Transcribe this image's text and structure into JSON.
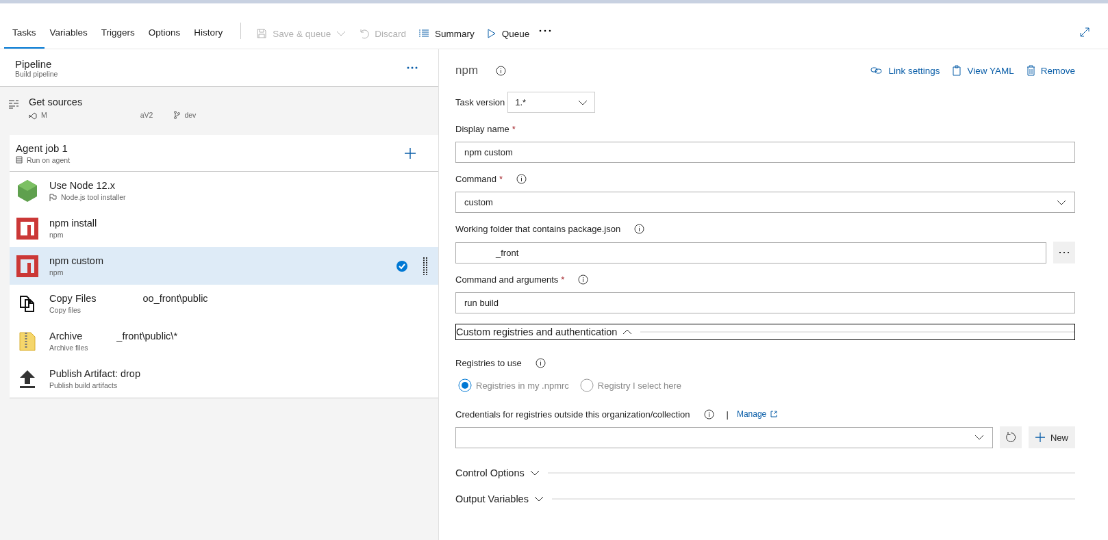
{
  "tabs": [
    {
      "label": "Tasks",
      "selected": true
    },
    {
      "label": "Variables",
      "selected": false
    },
    {
      "label": "Triggers",
      "selected": false
    },
    {
      "label": "Options",
      "selected": false
    },
    {
      "label": "History",
      "selected": false
    }
  ],
  "toolbar": [
    {
      "kind": "save",
      "label": "Save & queue",
      "disabled": true
    },
    {
      "kind": "discard",
      "label": "Discard",
      "disabled": true
    },
    {
      "kind": "summary",
      "label": "Summary",
      "disabled": false
    },
    {
      "kind": "queue",
      "label": "Queue",
      "disabled": false
    }
  ],
  "pipeline": {
    "title": "Pipeline",
    "subtitle": "Build pipeline"
  },
  "get_sources": {
    "title": "Get sources",
    "repo_start": "M",
    "repo_end": "aV2",
    "branch": "dev"
  },
  "agent_job": {
    "title": "Agent job 1",
    "subtitle": "Run on agent"
  },
  "tasks": [
    {
      "kind": "node",
      "title": "Use Node 12.x",
      "subtitle": "Node.js tool installer",
      "selected": false
    },
    {
      "kind": "npm",
      "title": "npm install",
      "subtitle": "npm",
      "selected": false
    },
    {
      "kind": "npm",
      "title": "npm custom",
      "subtitle": "npm",
      "selected": true
    },
    {
      "kind": "copy",
      "title": "Copy Files",
      "title_end": "oo_front\\public",
      "subtitle": "Copy files",
      "selected": false
    },
    {
      "kind": "archive",
      "title": "Archive",
      "title_end": "_front\\public\\*",
      "subtitle": "Archive files",
      "selected": false
    },
    {
      "kind": "publish",
      "title": "Publish Artifact: drop",
      "subtitle": "Publish build artifacts",
      "selected": false
    }
  ],
  "detail": {
    "title": "npm",
    "links": [
      {
        "kind": "link",
        "label": "Link settings"
      },
      {
        "kind": "yaml",
        "label": "View YAML"
      },
      {
        "kind": "remove",
        "label": "Remove"
      }
    ],
    "task_version": {
      "label": "Task version",
      "value": "1.*"
    },
    "fields": [
      {
        "kind": "text",
        "label": "Display name",
        "required": "*",
        "info": false,
        "value": "npm custom"
      },
      {
        "kind": "select",
        "label": "Command",
        "required": "*",
        "info": true,
        "value": "custom"
      },
      {
        "kind": "browse",
        "label": "Working folder that contains package.json",
        "info": true,
        "value": "_front"
      },
      {
        "kind": "text",
        "label": "Command and arguments",
        "required": "*",
        "info": true,
        "value": "run build"
      }
    ],
    "section": {
      "label": "Custom registries and authentication",
      "expanded": true
    },
    "registries": {
      "label": "Registries to use",
      "options": [
        {
          "label": "Registries in my .npmrc",
          "selected": true
        },
        {
          "label": "Registry I select here",
          "selected": false
        }
      ]
    },
    "credentials": {
      "label": "Credentials for registries outside this organization/collection",
      "separator": "|",
      "link": "Manage",
      "new_label": "New"
    },
    "collapsed": [
      {
        "label": "Control Options",
        "expanded": false
      },
      {
        "label": "Output Variables",
        "expanded": false
      }
    ]
  }
}
